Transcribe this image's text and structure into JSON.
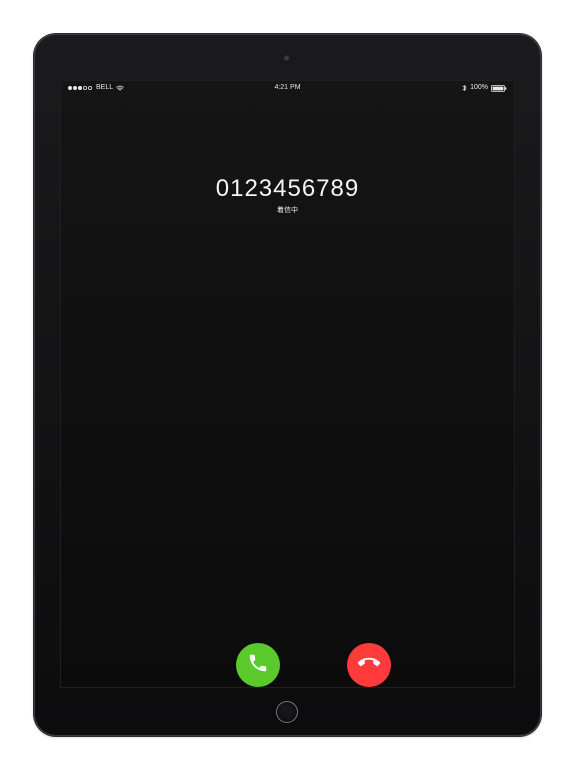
{
  "status_bar": {
    "carrier": "BELL",
    "time": "4:21 PM",
    "battery_percent": "100%",
    "signal": {
      "filled": 3,
      "total": 5
    }
  },
  "call": {
    "number": "0123456789",
    "status": "着信中"
  },
  "buttons": {
    "accept_icon": "phone-icon",
    "decline_icon": "phone-down-icon"
  },
  "colors": {
    "accept": "#5ac92b",
    "decline": "#ff3a3a",
    "screen": "#0f0f0f"
  },
  "icons": {
    "wifi": "wifi-icon",
    "bluetooth": "bluetooth-icon",
    "battery": "battery-icon"
  }
}
